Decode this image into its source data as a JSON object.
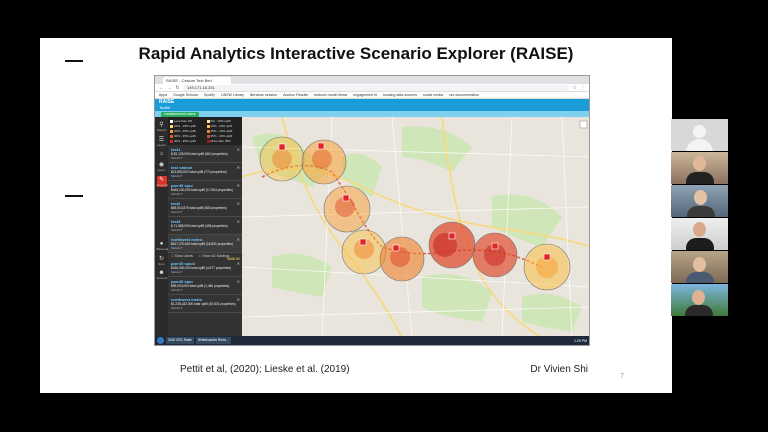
{
  "slide": {
    "title": "Rapid Analytics Interactive Scenario Explorer (RAISE)",
    "citation": "Pettit et al, (2020); Lieske et al. (2019)",
    "author": "Dr Vivien Shi",
    "page_number": "7"
  },
  "browser": {
    "tab_label": "RAISE - Cesium Test Bed",
    "url": "149.171.16.251",
    "bookmarks": [
      "Apps",
      "Google Scholar",
      "Spotify",
      "UNSW Library",
      "literature session",
      "Auction Results",
      "hedonic model literat",
      "engagement lit",
      "housing data sources",
      "social media",
      "csv documentation"
    ]
  },
  "raise": {
    "app_title": "RAISE",
    "app_subtitle": "Toolkit",
    "user_pill": "crowdsourced-users",
    "tools": [
      {
        "icon": "search-icon",
        "label": "Search"
      },
      {
        "icon": "layers-icon",
        "label": "Layers"
      },
      {
        "icon": "home-icon",
        "label": ""
      },
      {
        "icon": "stats-icon",
        "label": "Query"
      },
      {
        "icon": "scenario-icon",
        "label": "Scenarios"
      },
      {
        "icon": "globe-icon",
        "label": "Basemap"
      },
      {
        "icon": "refresh-icon",
        "label": "Sync"
      },
      {
        "icon": "user-icon",
        "label": "Account"
      }
    ],
    "legend": [
      "Less than 0%",
      "0% - 10% uplift",
      "10% - 15% uplift",
      "15% - 20% uplift",
      "20% - 25% uplift",
      "25% - 30% uplift",
      "30% - 35% uplift",
      "35% - 40% uplift",
      "40% - 45% uplift",
      "More than 45%"
    ],
    "scenarios": [
      {
        "name": "test1",
        "detail": "$ 82,128,000 total uplift (810 properties)",
        "link": "SELECT"
      },
      {
        "name": "test station",
        "detail": "$13,890,000 total uplift (774 properties)",
        "link": "SELECT"
      },
      {
        "name": "parr45 spur",
        "detail": "$446,100,000 total uplift (17,564 properties)",
        "link": "SELECT"
      },
      {
        "name": "test2",
        "detail": "$69,510,875 total uplift (583 properties)",
        "link": "SELECT"
      },
      {
        "name": "test3",
        "detail": "$ 71,585,000 total uplift (496 properties)",
        "link": "SELECT"
      },
      {
        "name": "northwest metro",
        "detail": "$617,270,604 total uplift (16,831 properties)",
        "link": "SELECT"
      },
      {
        "name": "parr45 spur2",
        "detail": "$186,000,000 total uplift (4,677 properties)",
        "link": "SELECT"
      },
      {
        "name": "parr45 spur",
        "detail": "$55,000,000 total uplift (1,480 properties)",
        "link": "SELECT"
      },
      {
        "name": "northwest metro",
        "detail": "$1,235,182,000 total uplift (19,831 properties)",
        "link": "SELECT"
      }
    ],
    "toggles": [
      "Show Labels",
      "Show 3D Buildings"
    ],
    "price_label": "$468.50"
  },
  "taskbar": {
    "items": [
      "2016 CRC Raise",
      "Whiteboarder Revis..."
    ],
    "clock": "1:25 PM"
  },
  "colors": {
    "raise_blue": "#1a9cd8",
    "panel_dark": "#333333",
    "uplift_low": "#ffd966",
    "uplift_mid": "#f39c12",
    "uplift_high": "#d9342b",
    "station_marker": "#e0242a"
  }
}
